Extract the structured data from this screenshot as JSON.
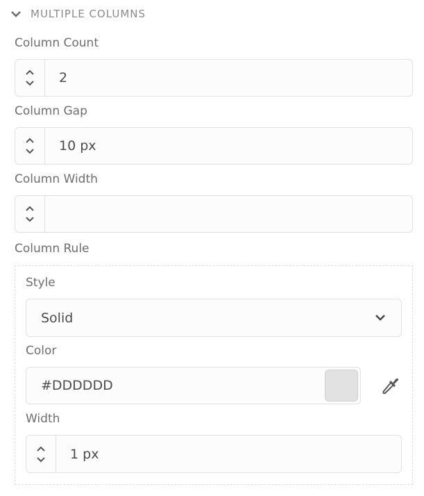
{
  "section": {
    "title": "MULTIPLE COLUMNS",
    "expanded": true
  },
  "column_count": {
    "label": "Column Count",
    "value": "2"
  },
  "column_gap": {
    "label": "Column Gap",
    "value": "10 px"
  },
  "column_width": {
    "label": "Column Width",
    "value": ""
  },
  "column_rule": {
    "label": "Column Rule",
    "style": {
      "label": "Style",
      "value": "Solid"
    },
    "color": {
      "label": "Color",
      "value": "#DDDDDD",
      "swatch": "#e2e2e2"
    },
    "width": {
      "label": "Width",
      "value": "1 px"
    }
  }
}
